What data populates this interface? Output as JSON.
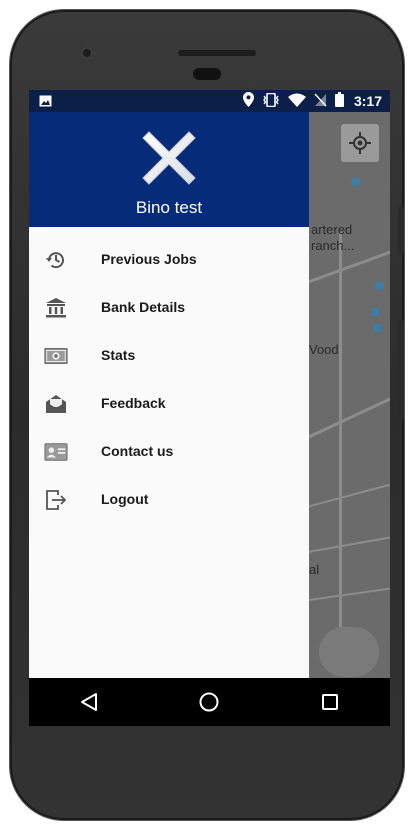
{
  "status_bar": {
    "time": "3:17",
    "icons": [
      "image-icon",
      "location-icon",
      "vibrate-icon",
      "wifi-icon",
      "no-sim-icon",
      "battery-icon"
    ]
  },
  "drawer": {
    "header_color": "#062b79",
    "user_name": "Bino  test",
    "logo_icon": "x-logo-icon",
    "items": [
      {
        "label": "Previous Jobs",
        "icon": "history-icon"
      },
      {
        "label": "Bank Details",
        "icon": "bank-icon"
      },
      {
        "label": "Stats",
        "icon": "cash-icon"
      },
      {
        "label": "Feedback",
        "icon": "mail-open-icon"
      },
      {
        "label": "Contact us",
        "icon": "contact-card-icon"
      },
      {
        "label": "Logout",
        "icon": "logout-icon"
      }
    ]
  },
  "map": {
    "labels": [
      "artered",
      "ranch...",
      "Vood",
      "al"
    ]
  },
  "nav_bar": {
    "buttons": [
      "back-icon",
      "home-icon",
      "recents-icon"
    ]
  }
}
